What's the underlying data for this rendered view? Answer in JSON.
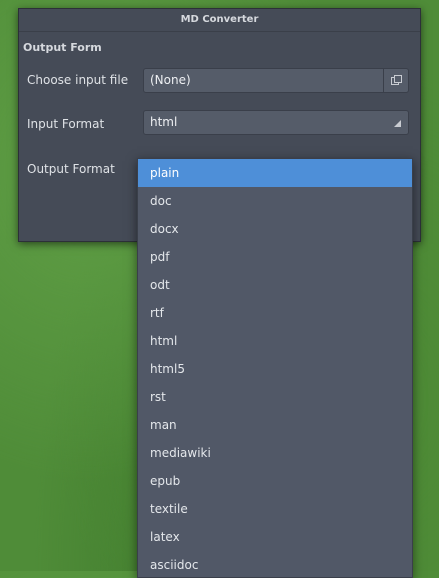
{
  "window": {
    "title": "MD Converter"
  },
  "form": {
    "section_label": "Output Form",
    "input_file": {
      "label": "Choose input file",
      "value": "(None)"
    },
    "input_format": {
      "label": "Input Format",
      "value": "html"
    },
    "output_format": {
      "label": "Output Format",
      "selected": "plain"
    }
  },
  "dropdown": {
    "options": [
      "plain",
      "doc",
      "docx",
      "pdf",
      "odt",
      "rtf",
      "html",
      "html5",
      "rst",
      "man",
      "mediawiki",
      "epub",
      "textile",
      "latex",
      "asciidoc"
    ],
    "highlighted_index": 0
  },
  "icons": {
    "file_button": "file-chooser-icon",
    "combo": "dropdown-arrow-icon"
  },
  "colors": {
    "accent": "#4e8fd8",
    "window_bg": "#454b57",
    "desktop_bg": "#4f8c38"
  }
}
